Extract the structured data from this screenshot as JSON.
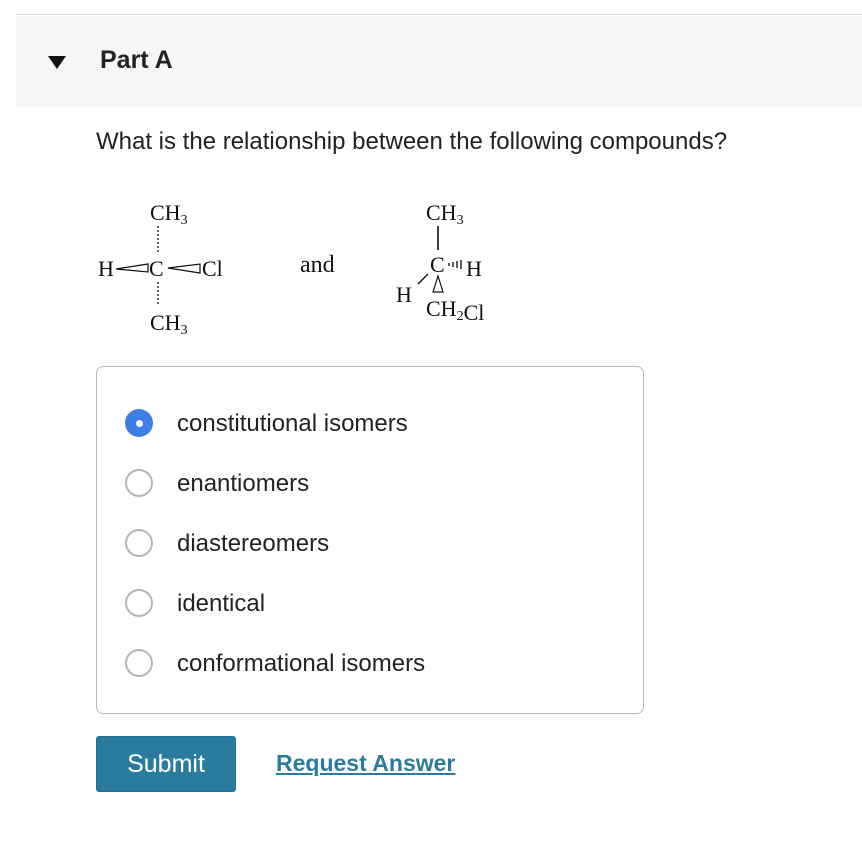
{
  "part": {
    "title": "Part A",
    "caret_icon": "caret-down-icon"
  },
  "question": {
    "text": "What is the relationship between the following compounds?",
    "connector": "and",
    "molecule1": {
      "top_group": "CH3",
      "left_atom": "H",
      "center_atom": "C",
      "right_atom": "Cl",
      "bottom_group": "CH3"
    },
    "molecule2": {
      "top_group": "CH3",
      "center_atom": "C",
      "right_atom": "H",
      "left_atom": "H",
      "bottom_group": "CH2Cl"
    }
  },
  "options": [
    {
      "label": "constitutional isomers",
      "selected": true
    },
    {
      "label": "enantiomers",
      "selected": false
    },
    {
      "label": "diastereomers",
      "selected": false
    },
    {
      "label": "identical",
      "selected": false
    },
    {
      "label": "conformational isomers",
      "selected": false
    }
  ],
  "actions": {
    "submit_label": "Submit",
    "request_answer_label": "Request Answer"
  },
  "colors": {
    "accent": "#2a7c9e",
    "radio_selected": "#3d7fe6",
    "header_bg": "#f6f6f6"
  }
}
